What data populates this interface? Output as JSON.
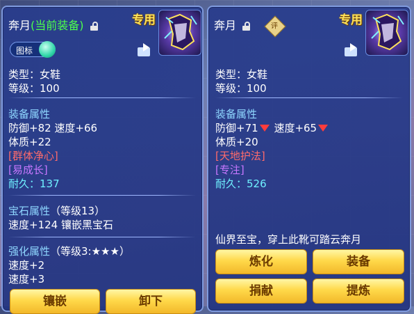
{
  "left_panel": {
    "name": "奔月",
    "name_suffix": "(当前装备)",
    "exclusive": "专用",
    "toggle_label": "图标",
    "type": "类型：女鞋",
    "level": "等级：100",
    "attr_heading": "装备属性",
    "attr_line1": "防御+82 速度+66",
    "attr_line2": "体质+22",
    "skill1": "[群体净心]",
    "skill2": "[易成长]",
    "durability_label": "耐久：",
    "durability_value": "137",
    "gem_heading": "宝石属性",
    "gem_level": "（等级13）",
    "gem_line": "速度+124 镶嵌黑宝石",
    "enhance_heading": "强化属性",
    "enhance_level": "（等级3:★★★）",
    "enhance_line1": "速度+2",
    "enhance_line2": "速度+3",
    "buttons": [
      "镶嵌",
      "卸下"
    ]
  },
  "right_panel": {
    "name": "奔月",
    "seal_char": "评",
    "exclusive": "专用",
    "type": "类型：女鞋",
    "level": "等级：100",
    "attr_heading": "装备属性",
    "defense": "防御+71",
    "speed": "速度+65",
    "attr_line2": "体质+20",
    "skill1": "[天地护法]",
    "skill2": "[专注]",
    "durability_label": "耐久：",
    "durability_value": "526",
    "description": "仙界至宝，穿上此靴可踏云奔月",
    "buttons": [
      "炼化",
      "装备",
      "捐献",
      "提炼"
    ]
  },
  "colors": {
    "panel": "#2a3c8a",
    "heading": "#8fd7ff",
    "green": "#4cff4c",
    "gold": "#ffe35a",
    "red_skill": "#ff6b6b",
    "purple_skill": "#c878ff",
    "durability": "#6ff0ff",
    "down_arrow": "#ff3c3c"
  }
}
